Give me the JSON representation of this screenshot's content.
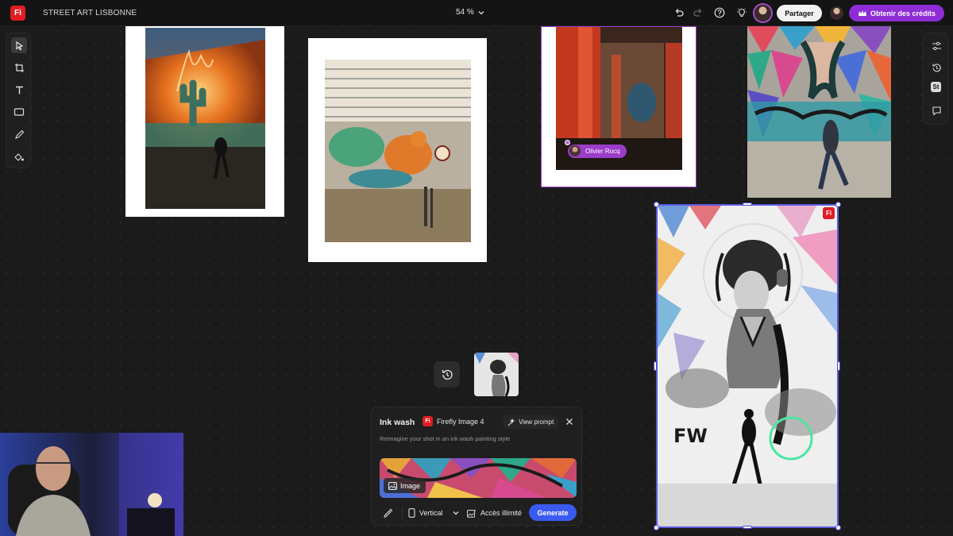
{
  "app": {
    "logo_text": "Fi",
    "document_title": "STREET ART LISBONNE",
    "zoom_level": "54 %"
  },
  "header": {
    "share_label": "Partager",
    "credits_label": "Obtenir des crédits"
  },
  "left_tools": [
    "select-tool",
    "frame-tool",
    "text-tool",
    "shape-tool",
    "pen-tool",
    "fill-tool"
  ],
  "right_tools": [
    "adjust",
    "history",
    "stock",
    "comments"
  ],
  "right_stock_label": "St",
  "canvas": {
    "collaborator_name": "Olivier Rocq",
    "selected_badge": "Fi"
  },
  "panel": {
    "title": "Ink wash",
    "model_logo": "Fi",
    "model_name": "Firefly Image 4",
    "view_prompt_label": "View prompt",
    "subtitle": "Reimagine your shot in an ink wash painting style",
    "image_chip_label": "Image",
    "orientation_label": "Vertical",
    "access_label": "Accès illimité",
    "generate_label": "Generate"
  },
  "colors": {
    "accent_purple": "#8e2dd6",
    "generate_blue": "#3a5bf0",
    "brand_red": "#e01d23",
    "selection_blue": "#5a5ae0"
  }
}
